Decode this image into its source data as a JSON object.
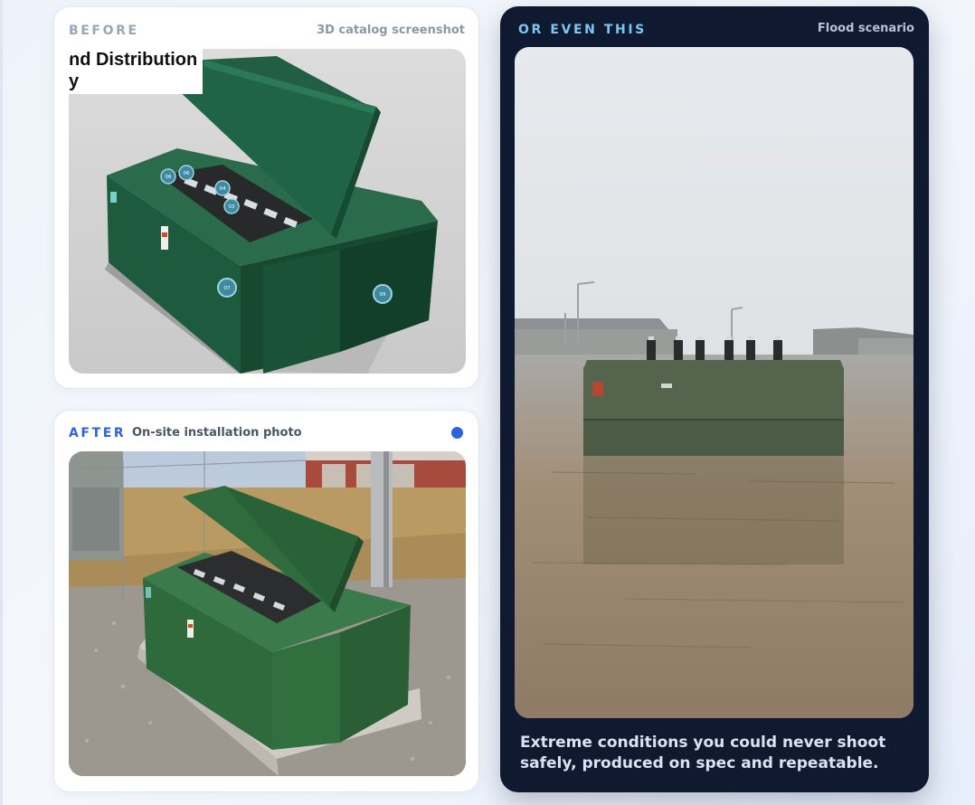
{
  "before": {
    "tag": "BEFORE",
    "subtitle": "3D catalog screenshot",
    "image_caption_line1": "nd Distribution",
    "image_caption_line2": "y",
    "hotspots": [
      "06",
      "06",
      "04",
      "03",
      "07",
      "09"
    ]
  },
  "after": {
    "tag": "AFTER",
    "subtitle": "On-site installation photo"
  },
  "flood": {
    "tag": "OR EVEN THIS",
    "subtitle": "Flood scenario",
    "caption": "Extreme conditions you could never shoot safely, produced on spec and repeatable."
  },
  "colors": {
    "accent_blue": "#2f62e0",
    "dark_card": "#0f1a31",
    "flood_tag": "#7cc6f4",
    "cabinet_green": "#1f5a3f"
  }
}
